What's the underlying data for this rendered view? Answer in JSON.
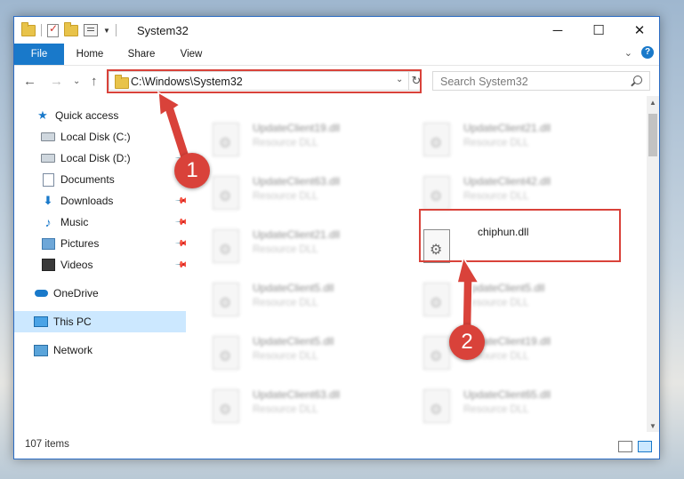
{
  "window": {
    "title": "System32"
  },
  "titlebar": {
    "minimize": "─",
    "maximize": "☐",
    "close": "✕"
  },
  "ribbon": {
    "tabs": [
      "File",
      "Home",
      "Share",
      "View"
    ],
    "expand": "⌄",
    "help": "?"
  },
  "nav": {
    "back": "←",
    "forward": "→",
    "recent": "⌄",
    "up": "↑"
  },
  "address": {
    "path": "C:\\Windows\\System32",
    "dropdown": "⌄",
    "refresh": "↻"
  },
  "search": {
    "placeholder": "Search System32"
  },
  "sidebar": {
    "items": [
      {
        "label": "Quick access",
        "icon": "star-icon"
      },
      {
        "label": "Local Disk (C:)",
        "icon": "drive-icon"
      },
      {
        "label": "Local Disk (D:)",
        "icon": "drive-icon"
      },
      {
        "label": "Documents",
        "icon": "documents-icon"
      },
      {
        "label": "Downloads",
        "icon": "downloads-icon"
      },
      {
        "label": "Music",
        "icon": "music-icon"
      },
      {
        "label": "Pictures",
        "icon": "pictures-icon"
      },
      {
        "label": "Videos",
        "icon": "videos-icon"
      },
      {
        "label": "OneDrive",
        "icon": "onedrive-icon"
      },
      {
        "label": "This PC",
        "icon": "pc-icon"
      },
      {
        "label": "Network",
        "icon": "network-icon"
      }
    ]
  },
  "files": {
    "left": [
      {
        "name": "UpdateClient19.dll",
        "type": "Resource DLL"
      },
      {
        "name": "UpdateClient63.dll",
        "type": "Resource DLL"
      },
      {
        "name": "UpdateClient21.dll",
        "type": "Resource DLL"
      },
      {
        "name": "UpdateClient5.dll",
        "type": "Resource DLL"
      },
      {
        "name": "UpdateClient5.dll",
        "type": "Resource DLL"
      },
      {
        "name": "UpdateClient63.dll",
        "type": "Resource DLL"
      }
    ],
    "right": [
      {
        "name": "UpdateClient21.dll",
        "type": "Resource DLL"
      },
      {
        "name": "UpdateClient42.dll",
        "type": "Resource DLL"
      },
      {
        "name": "chiphun.dll",
        "type": ""
      },
      {
        "name": "UpdateClient5.dll",
        "type": "Resource DLL"
      },
      {
        "name": "UpdateClient19.dll",
        "type": "Resource DLL"
      },
      {
        "name": "UpdateClient65.dll",
        "type": "Resource DLL"
      }
    ]
  },
  "status": {
    "count": "107 items"
  },
  "annotations": {
    "step1": "1",
    "step2": "2",
    "color": "#d9423a"
  }
}
